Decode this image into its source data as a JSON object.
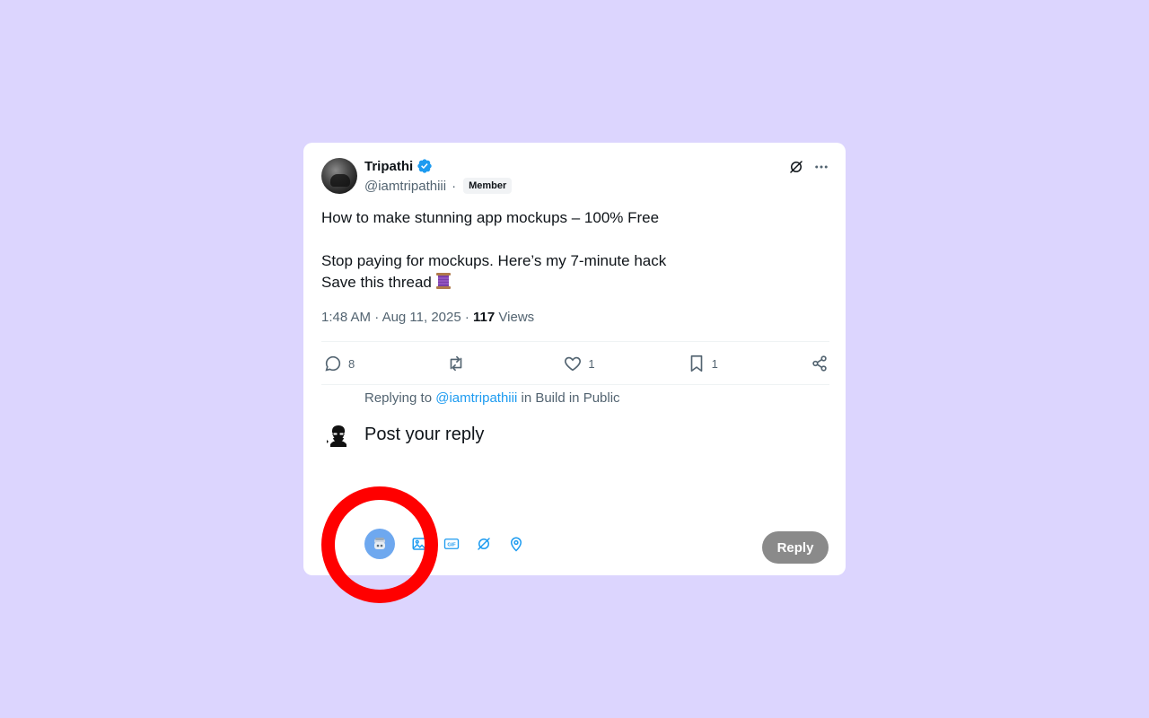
{
  "post": {
    "author_name": "Tripathi",
    "handle": "@iamtripathiii",
    "separator": "·",
    "badge": "Member",
    "line1": "How to make stunning app mockups – 100% Free",
    "line2": "Stop paying for mockups. Here’s my 7-minute hack",
    "line3": "Save this thread",
    "time": "1:48 AM",
    "date": "Aug 11, 2025",
    "views_count": "117",
    "views_label": "Views"
  },
  "actions": {
    "replies": "8",
    "reposts": "",
    "likes": "1",
    "bookmarks": "1"
  },
  "compose": {
    "replying_prefix": "Replying to",
    "replying_mention": "@iamtripathiii",
    "replying_suffix": "in Build in Public",
    "placeholder": "Post your reply",
    "reply_button": "Reply"
  },
  "colors": {
    "background": "#dcd5fe",
    "accent": "#1d9bf0",
    "grok_button": "#6ea8ef",
    "reply_button": "#8a8a8a",
    "highlight_ring": "#ff0000"
  },
  "icons": {
    "verified": "verified-badge-icon",
    "grok": "grok-icon",
    "more": "more-icon",
    "reply": "reply-icon",
    "repost": "repost-icon",
    "like": "heart-icon",
    "bookmark": "bookmark-icon",
    "share": "share-icon",
    "thread": "thread-spool-icon",
    "image": "image-icon",
    "gif": "gif-icon",
    "location": "location-icon"
  }
}
